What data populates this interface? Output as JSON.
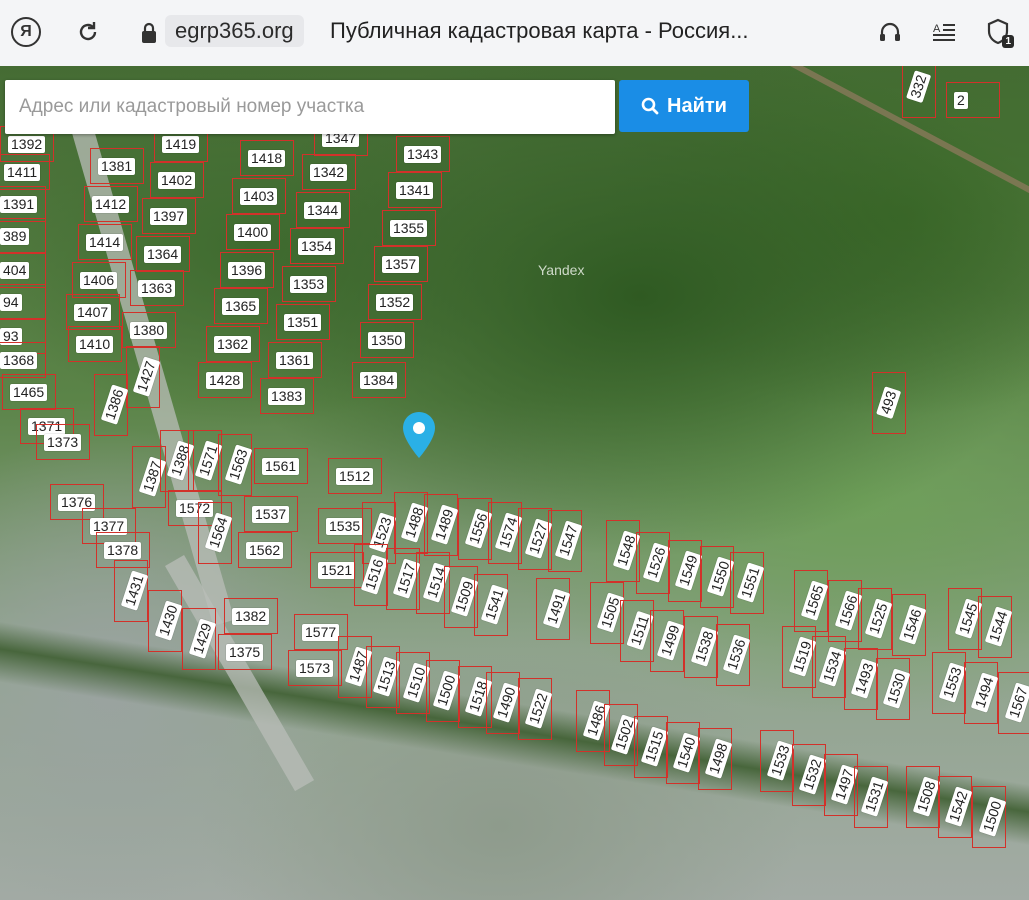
{
  "browser": {
    "url": "egrp365.org",
    "title": "Публичная кадастровая карта - Россия...",
    "notification_badge": "1"
  },
  "search": {
    "placeholder": "Адрес или кадастровый номер участка",
    "button_label": "Найти"
  },
  "map": {
    "watermark": "Yandex",
    "parcels": [
      {
        "label": "1392"
      },
      {
        "label": "1411"
      },
      {
        "label": "1391"
      },
      {
        "label": "389"
      },
      {
        "label": "404"
      },
      {
        "label": "94"
      },
      {
        "label": "93"
      },
      {
        "label": "1368"
      },
      {
        "label": "1465"
      },
      {
        "label": "1371"
      },
      {
        "label": "1373"
      },
      {
        "label": "1381"
      },
      {
        "label": "1412"
      },
      {
        "label": "1414"
      },
      {
        "label": "1406"
      },
      {
        "label": "1407"
      },
      {
        "label": "1410"
      },
      {
        "label": "1419"
      },
      {
        "label": "1402"
      },
      {
        "label": "1397"
      },
      {
        "label": "1364"
      },
      {
        "label": "1363"
      },
      {
        "label": "1380"
      },
      {
        "label": "1427"
      },
      {
        "label": "1386"
      },
      {
        "label": "1418"
      },
      {
        "label": "1403"
      },
      {
        "label": "1400"
      },
      {
        "label": "1396"
      },
      {
        "label": "1365"
      },
      {
        "label": "1362"
      },
      {
        "label": "1428"
      },
      {
        "label": "1342"
      },
      {
        "label": "1344"
      },
      {
        "label": "1354"
      },
      {
        "label": "1353"
      },
      {
        "label": "1351"
      },
      {
        "label": "1361"
      },
      {
        "label": "1383"
      },
      {
        "label": "1343"
      },
      {
        "label": "1341"
      },
      {
        "label": "1355"
      },
      {
        "label": "1357"
      },
      {
        "label": "1352"
      },
      {
        "label": "1350"
      },
      {
        "label": "1384"
      },
      {
        "label": "1376"
      },
      {
        "label": "1377"
      },
      {
        "label": "1378"
      },
      {
        "label": "1431"
      },
      {
        "label": "1430"
      },
      {
        "label": "1429"
      },
      {
        "label": "1382"
      },
      {
        "label": "1375"
      },
      {
        "label": "1387"
      },
      {
        "label": "1388"
      },
      {
        "label": "1571"
      },
      {
        "label": "1563"
      },
      {
        "label": "1561"
      },
      {
        "label": "1572"
      },
      {
        "label": "1564"
      },
      {
        "label": "1537"
      },
      {
        "label": "1562"
      },
      {
        "label": "1512"
      },
      {
        "label": "1535"
      },
      {
        "label": "1521"
      },
      {
        "label": "1523"
      },
      {
        "label": "1488"
      },
      {
        "label": "1489"
      },
      {
        "label": "1556"
      },
      {
        "label": "1574"
      },
      {
        "label": "1527"
      },
      {
        "label": "1547"
      },
      {
        "label": "1516"
      },
      {
        "label": "1517"
      },
      {
        "label": "1514"
      },
      {
        "label": "1509"
      },
      {
        "label": "1541"
      },
      {
        "label": "1491"
      },
      {
        "label": "1577"
      },
      {
        "label": "1573"
      },
      {
        "label": "1487"
      },
      {
        "label": "1513"
      },
      {
        "label": "1510"
      },
      {
        "label": "1500"
      },
      {
        "label": "1518"
      },
      {
        "label": "1490"
      },
      {
        "label": "1522"
      },
      {
        "label": "1548"
      },
      {
        "label": "1526"
      },
      {
        "label": "1549"
      },
      {
        "label": "1550"
      },
      {
        "label": "1551"
      },
      {
        "label": "1505"
      },
      {
        "label": "1511"
      },
      {
        "label": "1499"
      },
      {
        "label": "1538"
      },
      {
        "label": "1536"
      },
      {
        "label": "1486"
      },
      {
        "label": "1502"
      },
      {
        "label": "1515"
      },
      {
        "label": "1540"
      },
      {
        "label": "1498"
      },
      {
        "label": "1565"
      },
      {
        "label": "1566"
      },
      {
        "label": "1525"
      },
      {
        "label": "1546"
      },
      {
        "label": "1519"
      },
      {
        "label": "1534"
      },
      {
        "label": "1493"
      },
      {
        "label": "1530"
      },
      {
        "label": "1533"
      },
      {
        "label": "1532"
      },
      {
        "label": "1497"
      },
      {
        "label": "1531"
      },
      {
        "label": "1545"
      },
      {
        "label": "1544"
      },
      {
        "label": "1553"
      },
      {
        "label": "1494"
      },
      {
        "label": "1567"
      },
      {
        "label": "1508"
      },
      {
        "label": "1542"
      },
      {
        "label": "1500"
      },
      {
        "label": "1347"
      },
      {
        "label": "493"
      },
      {
        "label": "332"
      },
      {
        "label": "2"
      }
    ]
  },
  "colors": {
    "parcel_border": "#d2312a",
    "search_button": "#1a8de6",
    "marker": "#2ab0e6"
  }
}
